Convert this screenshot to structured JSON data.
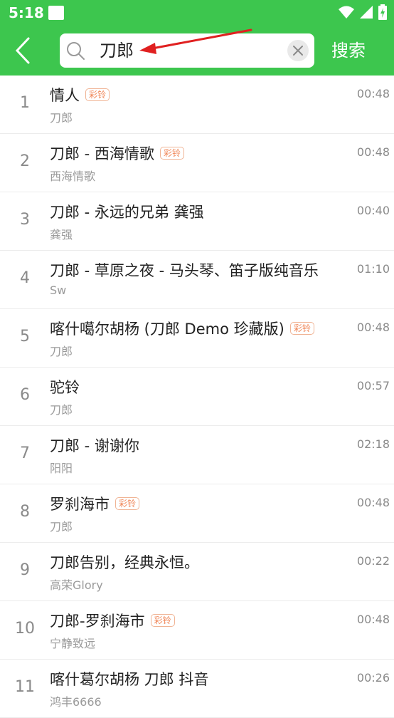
{
  "status": {
    "time": "5:18"
  },
  "search": {
    "query": "刀郎",
    "submit_label": "搜索"
  },
  "colors": {
    "accent": "#3dc64e",
    "badge": "#f0885a",
    "arrow": "#e02020"
  },
  "results": [
    {
      "num": "1",
      "title": "情人",
      "badge": "彩铃",
      "artist": "刀郎",
      "duration": "00:48"
    },
    {
      "num": "2",
      "title": "刀郎 - 西海情歌",
      "badge": "彩铃",
      "artist": "西海情歌",
      "duration": "00:48"
    },
    {
      "num": "3",
      "title": "刀郎 - 永远的兄弟 龚强",
      "badge": "",
      "artist": "龚强",
      "duration": "00:40"
    },
    {
      "num": "4",
      "title": "刀郎 - 草原之夜 - 马头琴、笛子版纯音乐",
      "badge": "",
      "artist": "Sw",
      "duration": "01:10"
    },
    {
      "num": "5",
      "title": "喀什噶尔胡杨 (刀郎 Demo 珍藏版)",
      "badge": "彩铃",
      "artist": "刀郎",
      "duration": "00:48"
    },
    {
      "num": "6",
      "title": "驼铃",
      "badge": "",
      "artist": "刀郎",
      "duration": "00:57"
    },
    {
      "num": "7",
      "title": "刀郎 - 谢谢你",
      "badge": "",
      "artist": "阳阳",
      "duration": "02:18"
    },
    {
      "num": "8",
      "title": "罗刹海市",
      "badge": "彩铃",
      "artist": "刀郎",
      "duration": "00:48"
    },
    {
      "num": "9",
      "title": "刀郎告别，经典永恒。",
      "badge": "",
      "artist": "高荣Glory",
      "duration": "00:22"
    },
    {
      "num": "10",
      "title": "刀郎-罗刹海市",
      "badge": "彩铃",
      "artist": "宁静致远",
      "duration": "00:48"
    },
    {
      "num": "11",
      "title": "喀什葛尔胡杨 刀郎 抖音",
      "badge": "",
      "artist": "鸿丰6666",
      "duration": "00:26"
    }
  ]
}
